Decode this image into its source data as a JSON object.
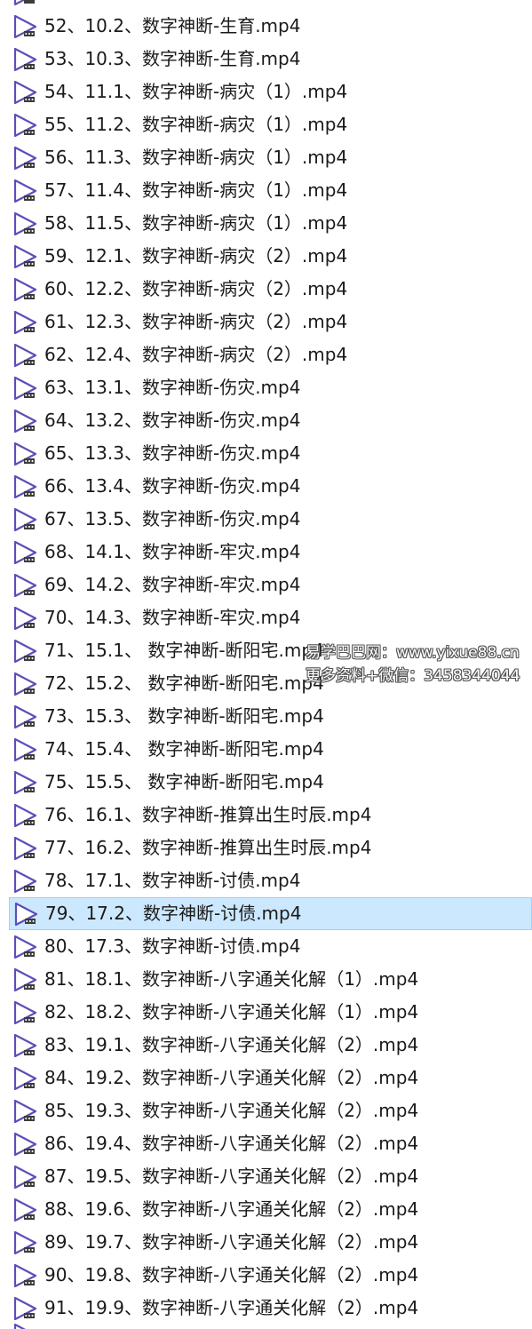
{
  "files": [
    {
      "name": "52、10.2、数字神断-生育.mp4",
      "selected": false
    },
    {
      "name": "53、10.3、数字神断-生育.mp4",
      "selected": false
    },
    {
      "name": "54、11.1、数字神断-病灾（1）.mp4",
      "selected": false
    },
    {
      "name": "55、11.2、数字神断-病灾（1）.mp4",
      "selected": false
    },
    {
      "name": "56、11.3、数字神断-病灾（1）.mp4",
      "selected": false
    },
    {
      "name": "57、11.4、数字神断-病灾（1）.mp4",
      "selected": false
    },
    {
      "name": "58、11.5、数字神断-病灾（1）.mp4",
      "selected": false
    },
    {
      "name": "59、12.1、数字神断-病灾（2）.mp4",
      "selected": false
    },
    {
      "name": "60、12.2、数字神断-病灾（2）.mp4",
      "selected": false
    },
    {
      "name": "61、12.3、数字神断-病灾（2）.mp4",
      "selected": false
    },
    {
      "name": "62、12.4、数字神断-病灾（2）.mp4",
      "selected": false
    },
    {
      "name": "63、13.1、数字神断-伤灾.mp4",
      "selected": false
    },
    {
      "name": "64、13.2、数字神断-伤灾.mp4",
      "selected": false
    },
    {
      "name": "65、13.3、数字神断-伤灾.mp4",
      "selected": false
    },
    {
      "name": "66、13.4、数字神断-伤灾.mp4",
      "selected": false
    },
    {
      "name": "67、13.5、数字神断-伤灾.mp4",
      "selected": false
    },
    {
      "name": "68、14.1、数字神断-牢灾.mp4",
      "selected": false
    },
    {
      "name": "69、14.2、数字神断-牢灾.mp4",
      "selected": false
    },
    {
      "name": "70、14.3、数字神断-牢灾.mp4",
      "selected": false
    },
    {
      "name": "71、15.1、 数字神断-断阳宅.mp4",
      "selected": false
    },
    {
      "name": "72、15.2、 数字神断-断阳宅.mp4",
      "selected": false
    },
    {
      "name": "73、15.3、 数字神断-断阳宅.mp4",
      "selected": false
    },
    {
      "name": "74、15.4、 数字神断-断阳宅.mp4",
      "selected": false
    },
    {
      "name": "75、15.5、 数字神断-断阳宅.mp4",
      "selected": false
    },
    {
      "name": "76、16.1、数字神断-推算出生时辰.mp4",
      "selected": false
    },
    {
      "name": "77、16.2、数字神断-推算出生时辰.mp4",
      "selected": false
    },
    {
      "name": "78、17.1、数字神断-讨债.mp4",
      "selected": false
    },
    {
      "name": "79、17.2、数字神断-讨债.mp4",
      "selected": true
    },
    {
      "name": "80、17.3、数字神断-讨债.mp4",
      "selected": false
    },
    {
      "name": "81、18.1、数字神断-八字通关化解（1）.mp4",
      "selected": false
    },
    {
      "name": "82、18.2、数字神断-八字通关化解（1）.mp4",
      "selected": false
    },
    {
      "name": "83、19.1、数字神断-八字通关化解（2）.mp4",
      "selected": false
    },
    {
      "name": "84、19.2、数字神断-八字通关化解（2）.mp4",
      "selected": false
    },
    {
      "name": "85、19.3、数字神断-八字通关化解（2）.mp4",
      "selected": false
    },
    {
      "name": "86、19.4、数字神断-八字通关化解（2）.mp4",
      "selected": false
    },
    {
      "name": "87、19.5、数字神断-八字通关化解（2）.mp4",
      "selected": false
    },
    {
      "name": "88、19.6、数字神断-八字通关化解（2）.mp4",
      "selected": false
    },
    {
      "name": "89、19.7、数字神断-八字通关化解（2）.mp4",
      "selected": false
    },
    {
      "name": "90、19.8、数字神断-八字通关化解（2）.mp4",
      "selected": false
    },
    {
      "name": "91、19.9、数字神断-八字通关化解（2）.mp4",
      "selected": false
    }
  ],
  "file_icon": "video-file-icon",
  "watermark": {
    "line1": "易学巴巴网：www.yixue88.cn",
    "line2": "更多资料+微信：3458344044"
  },
  "colors": {
    "selected_background": "#cce8ff",
    "selected_border": "#99d1ff",
    "icon_outline": "#5b4fb8",
    "text": "#1a1a1a"
  }
}
